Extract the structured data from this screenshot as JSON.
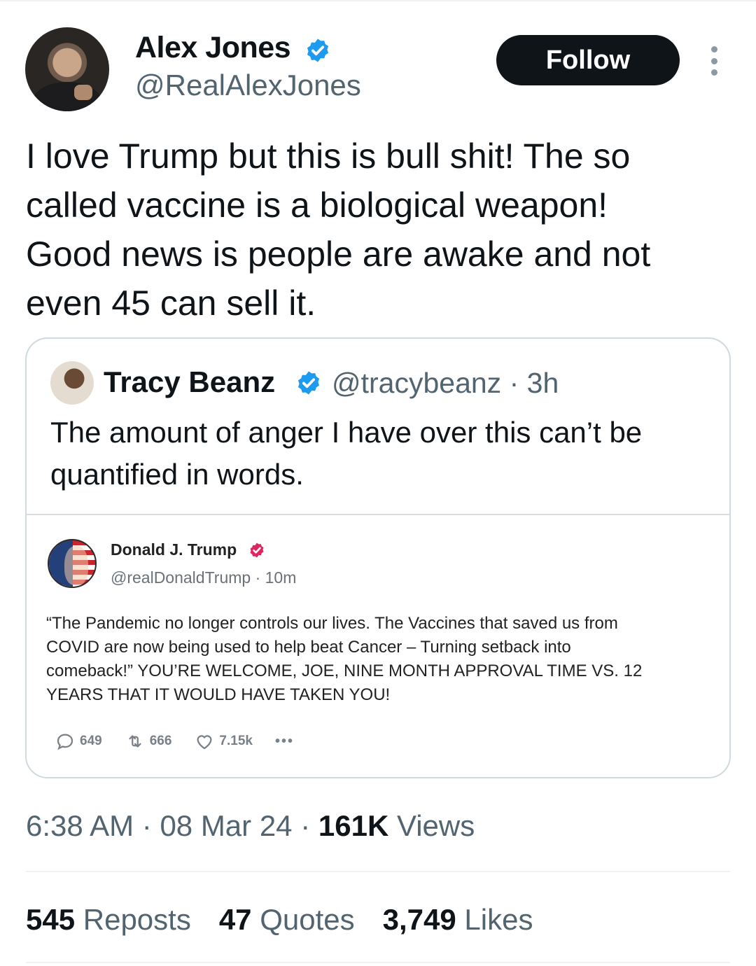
{
  "author": {
    "name": "Alex Jones",
    "handle": "@RealAlexJones",
    "verified": true
  },
  "follow_label": "Follow",
  "tweet": {
    "line1": "I love Trump but this is bull shit! The so",
    "line2": "called vaccine is a biological weapon!",
    "line3": "Good news is people are awake and not",
    "line4": "even 45 can sell it."
  },
  "quoted": {
    "name": "Tracy Beanz",
    "handle": "@tracybeanz",
    "time": "3h",
    "line1": "The amount of anger I have over this can’t be",
    "line2": "quantified in words."
  },
  "embedded": {
    "name": "Donald J. Trump",
    "handle": "@realDonaldTrump",
    "time": "10m",
    "line1": "“The Pandemic no longer controls our lives. The Vaccines that saved us from",
    "line2": "COVID are now being used to help beat Cancer – Turning setback into",
    "line3": "comeback!” YOU’RE WELCOME, JOE, NINE MONTH APPROVAL TIME VS. 12",
    "line4": "YEARS THAT IT WOULD HAVE TAKEN YOU!",
    "replies": "649",
    "reposts": "666",
    "likes": "7.15k",
    "more": "•••"
  },
  "meta": {
    "time": "6:38 AM",
    "date": "08 Mar 24",
    "views_count": "161K",
    "views_label": "Views"
  },
  "stats": {
    "reposts_count": "545",
    "reposts_label": "Reposts",
    "quotes_count": "47",
    "quotes_label": "Quotes",
    "likes_count": "3,749",
    "likes_label": "Likes"
  },
  "colors": {
    "verified_blue": "#1d9bf0",
    "verified_pink": "#e0245e",
    "secondary_text": "#536471"
  }
}
